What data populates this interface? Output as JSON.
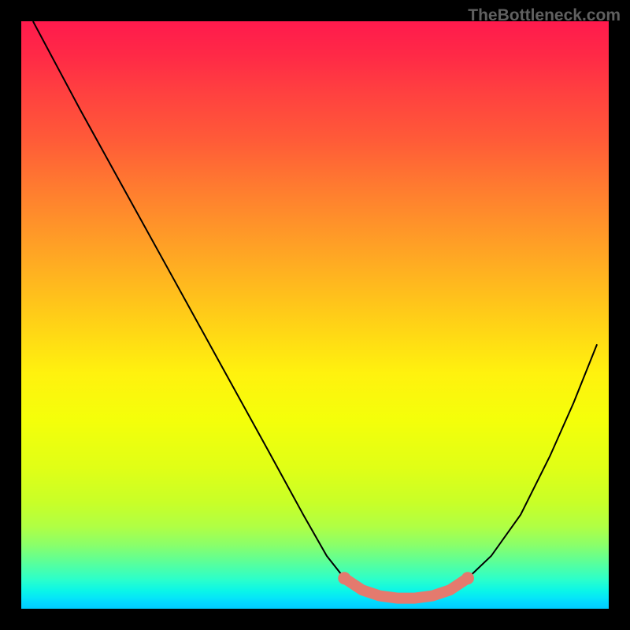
{
  "watermark": "TheBottleneck.com",
  "chart_data": {
    "type": "line",
    "title": "",
    "xlabel": "",
    "ylabel": "",
    "xlim": [
      0,
      100
    ],
    "ylim": [
      0,
      100
    ],
    "series": [
      {
        "name": "curve",
        "style": "thin-black",
        "x": [
          2,
          10,
          18,
          26,
          34,
          42,
          48,
          52,
          55,
          58,
          61,
          64,
          67,
          70,
          73,
          76,
          80,
          85,
          90,
          94,
          98
        ],
        "values": [
          100,
          85,
          70.5,
          56,
          41.5,
          27,
          16,
          9,
          5.2,
          3.2,
          2.2,
          1.8,
          1.8,
          2.2,
          3.2,
          5.2,
          9,
          16,
          26,
          35,
          45
        ]
      },
      {
        "name": "bottom-band",
        "style": "thick-coral",
        "x": [
          55,
          58,
          61,
          64,
          67,
          70,
          73,
          76
        ],
        "values": [
          5.2,
          3.2,
          2.2,
          1.8,
          1.8,
          2.2,
          3.2,
          5.2
        ]
      }
    ],
    "background": "rainbow-gradient-vertical"
  }
}
